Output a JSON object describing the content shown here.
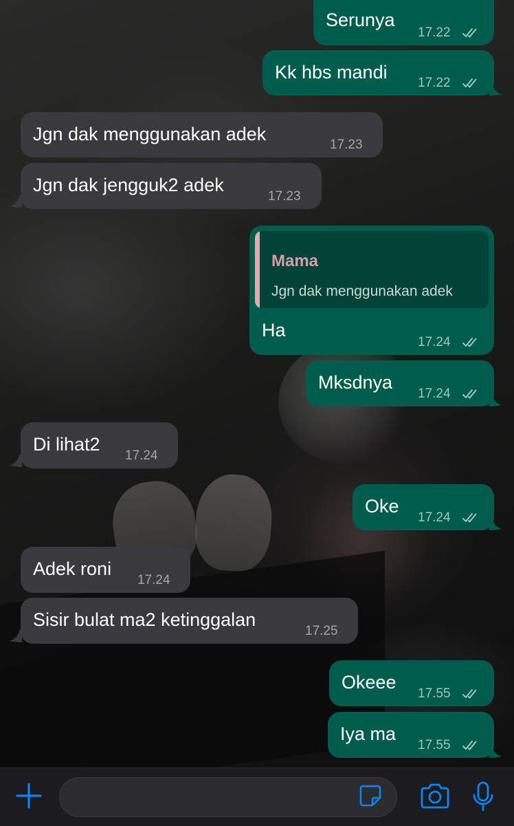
{
  "messages": [
    {
      "id": "m1",
      "dir": "out",
      "text": "Serunya",
      "time": "17.22",
      "read": true
    },
    {
      "id": "m2",
      "dir": "out",
      "text": "Kk hbs mandi",
      "time": "17.22",
      "read": true
    },
    {
      "id": "m3",
      "dir": "in",
      "text": "Jgn dak menggunakan adek",
      "time": "17.23"
    },
    {
      "id": "m4",
      "dir": "in",
      "text": "Jgn dak jengguk2 adek",
      "time": "17.23"
    },
    {
      "id": "m5",
      "dir": "out",
      "text": "Ha",
      "time": "17.24",
      "read": true,
      "reply_to": {
        "name": "Mama",
        "text": "Jgn dak menggunakan adek"
      }
    },
    {
      "id": "m6",
      "dir": "out",
      "text": "Mksdnya",
      "time": "17.24",
      "read": true
    },
    {
      "id": "m7",
      "dir": "in",
      "text": "Di lihat2",
      "time": "17.24"
    },
    {
      "id": "m8",
      "dir": "out",
      "text": "Oke",
      "time": "17.24",
      "read": true
    },
    {
      "id": "m9",
      "dir": "in",
      "text": "Adek roni",
      "time": "17.24"
    },
    {
      "id": "m10",
      "dir": "in",
      "text": "Sisir bulat ma2 ketinggalan",
      "time": "17.25"
    },
    {
      "id": "m11",
      "dir": "out",
      "text": "Okeee",
      "time": "17.55",
      "read": true
    },
    {
      "id": "m12",
      "dir": "out",
      "text": "Iya ma",
      "time": "17.55",
      "read": true
    }
  ],
  "input_bar": {
    "placeholder": "",
    "icons": [
      "plus-icon",
      "sticker-icon",
      "camera-icon",
      "microphone-icon"
    ],
    "accent_color": "#0a84ff"
  },
  "colors": {
    "outgoing_bubble": "#005c4b",
    "incoming_bubble": "#3a3a3c",
    "read_ticks": "#9ec7bd",
    "quote_accent": "#e4a9b0"
  }
}
